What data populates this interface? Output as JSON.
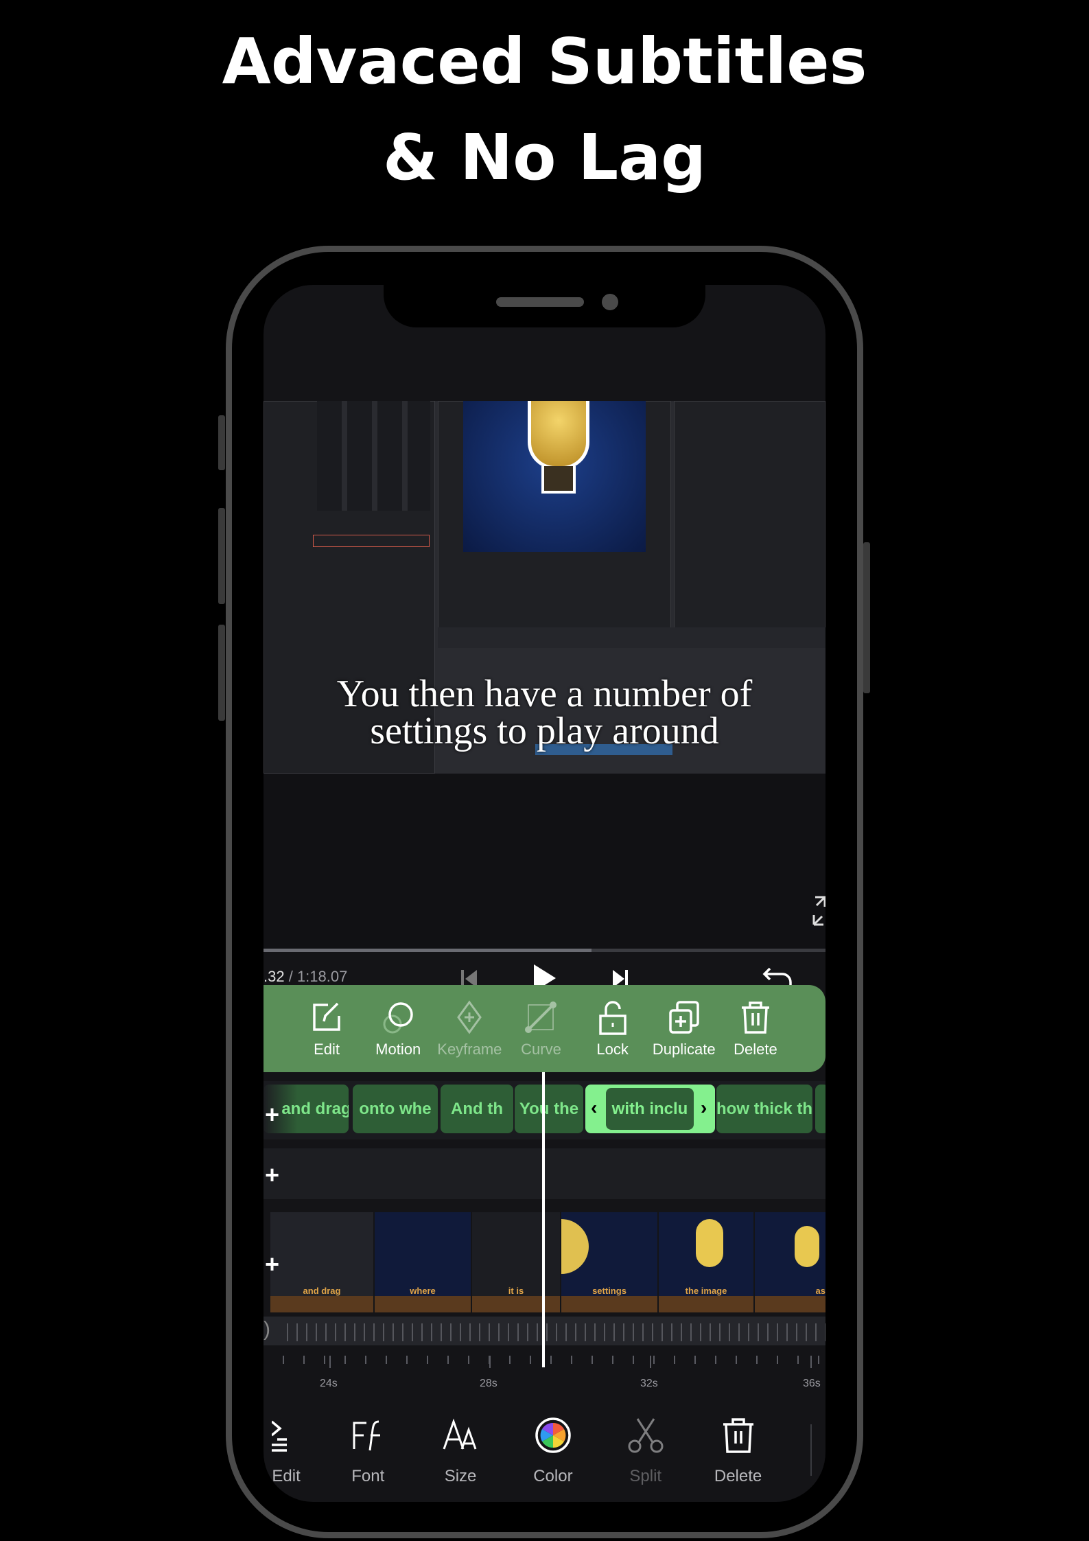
{
  "headline": {
    "line1": "Advaced Subtitles",
    "line2": "& No Lag"
  },
  "video": {
    "subtitle_line1": "You then have a number of",
    "subtitle_line2": "settings to play around",
    "progress_percent": 35
  },
  "player": {
    "current_time": ".32",
    "total_time": "/ 1:18.07"
  },
  "clip_toolbar": {
    "color": "#5a8f58",
    "items": [
      {
        "label": "Edit",
        "icon": "edit-icon",
        "enabled": true
      },
      {
        "label": "Motion",
        "icon": "motion-icon",
        "enabled": true
      },
      {
        "label": "Keyframe",
        "icon": "keyframe-icon",
        "enabled": false
      },
      {
        "label": "Curve",
        "icon": "curve-icon",
        "enabled": false
      },
      {
        "label": "Lock",
        "icon": "lock-icon",
        "enabled": true
      },
      {
        "label": "Duplicate",
        "icon": "duplicate-icon",
        "enabled": true
      },
      {
        "label": "Delete",
        "icon": "trash-icon",
        "enabled": true
      }
    ]
  },
  "subtitle_track": {
    "clips": [
      "and drag",
      "onto whe",
      "And th",
      "You the",
      "with inclu",
      "how thick th"
    ],
    "selected": "with inclu",
    "selected_color": "#84f08e"
  },
  "video_track": {
    "thumbnail_captions": [
      "and drag",
      "where",
      "it is",
      "settings",
      "the image",
      "as"
    ]
  },
  "ruler": {
    "labels": [
      "24s",
      "28s",
      "32s",
      "36s"
    ]
  },
  "bottom_toolbar": {
    "items": [
      {
        "label": "Edit",
        "icon": "edit-lines-icon",
        "enabled": true
      },
      {
        "label": "Font",
        "icon": "font-icon",
        "enabled": true
      },
      {
        "label": "Size",
        "icon": "text-size-icon",
        "enabled": true
      },
      {
        "label": "Color",
        "icon": "color-wheel-icon",
        "enabled": true
      },
      {
        "label": "Split",
        "icon": "scissors-icon",
        "enabled": false
      },
      {
        "label": "Delete",
        "icon": "trash-icon",
        "enabled": true
      }
    ]
  }
}
